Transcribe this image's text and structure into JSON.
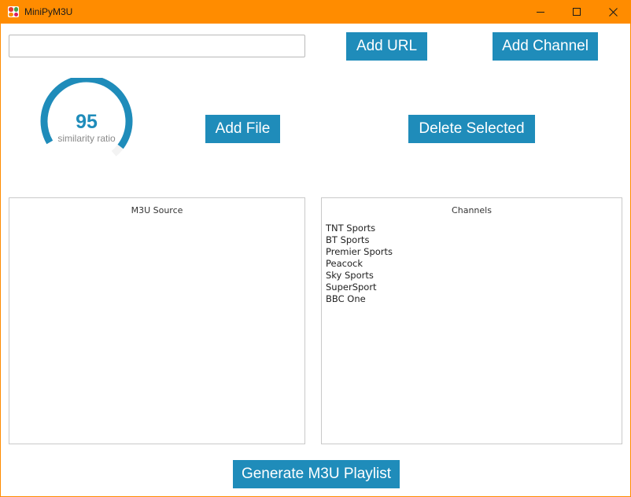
{
  "window": {
    "title": "MiniPyM3U",
    "app_icon_colors": [
      "#e53935",
      "#43a047",
      "#fb8c00",
      "#d81b60"
    ],
    "titlebar_color": "#ff8c00"
  },
  "toolbar": {
    "url_input_value": "",
    "url_input_placeholder": "",
    "add_url_label": "Add URL",
    "add_channel_label": "Add Channel",
    "add_file_label": "Add File",
    "delete_selected_label": "Delete Selected"
  },
  "gauge": {
    "value": "95",
    "percent": 95,
    "label": "similarity ratio",
    "color": "#1f8cba"
  },
  "panels": {
    "source": {
      "title": "M3U Source",
      "items": []
    },
    "channels": {
      "title": "Channels",
      "items": [
        "TNT Sports",
        "BT Sports",
        "Premier Sports",
        "Peacock",
        "Sky Sports",
        "SuperSport",
        "BBC One"
      ]
    }
  },
  "footer": {
    "generate_label": "Generate M3U Playlist"
  },
  "colors": {
    "accent": "#1f8cba"
  }
}
